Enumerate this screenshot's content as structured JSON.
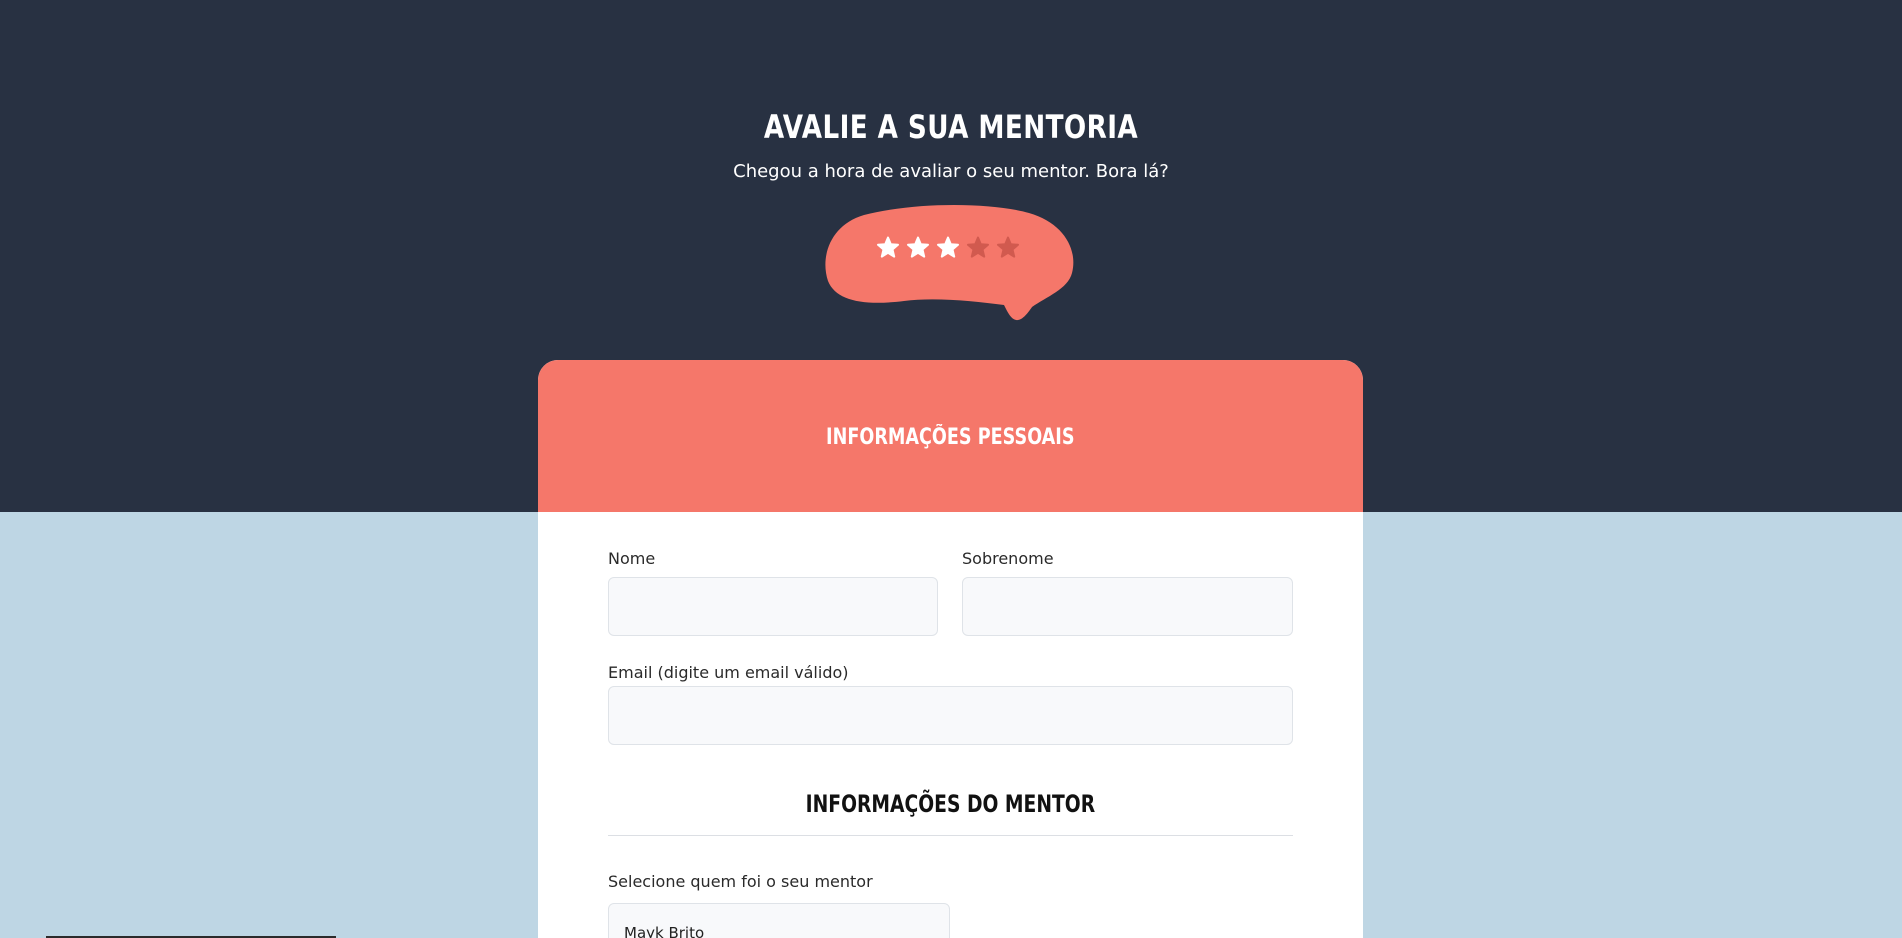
{
  "header": {
    "title": "AVALIE A SUA MENTORIA",
    "subtitle": "Chegou a hora de avaliar o seu mentor. Bora lá?"
  },
  "rating": {
    "value": 3,
    "max": 5,
    "filled_color": "#ffffff",
    "empty_color": "#d15a4f",
    "bubble_color": "#f5776a"
  },
  "card": {
    "header_title": "INFORMAÇÕES PESSOAIS",
    "fields": {
      "first_name_label": "Nome",
      "first_name_value": "",
      "last_name_label": "Sobrenome",
      "last_name_value": "",
      "email_label": "Email (digite um email válido)",
      "email_value": ""
    },
    "mentor_section": {
      "title": "INFORMAÇÕES DO MENTOR",
      "select_label": "Selecione quem foi o seu mentor",
      "select_value": "Mayk Brito"
    }
  },
  "colors": {
    "hero_bg": "#283142",
    "page_bg": "#bed6e4",
    "accent": "#f5776a"
  }
}
